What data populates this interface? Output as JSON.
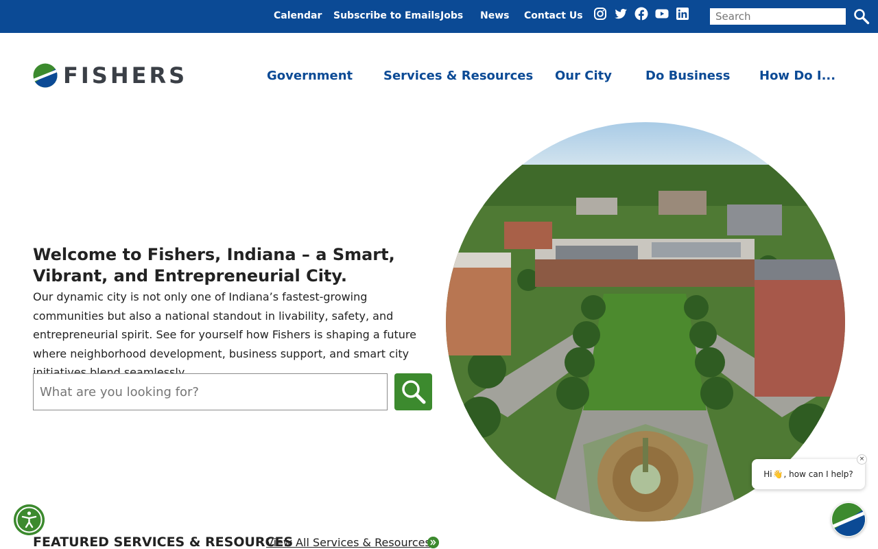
{
  "topbar": {
    "links": [
      "Calendar",
      "Subscribe to Emails",
      "Jobs",
      "News",
      "Contact Us"
    ],
    "social_icons": [
      "instagram-icon",
      "twitter-icon",
      "facebook-icon",
      "youtube-icon",
      "linkedin-icon"
    ],
    "search_placeholder": "Search",
    "color": "#0b4a95"
  },
  "header": {
    "logo_text": "FISHERS",
    "nav": [
      "Government",
      "Services & Resources",
      "Our City",
      "Do Business",
      "How Do I..."
    ]
  },
  "hero": {
    "title": "Welcome to Fishers, Indiana – a Smart, Vibrant, and Entrepreneurial City.",
    "body": "Our dynamic city is not only one of Indiana’s fastest-growing communities but also a national standout in livability, safety, and entrepreneurial spirit. See for yourself how Fishers is shaping a future where neighborhood development, business support, and smart city initiatives blend seamlessly.",
    "search_placeholder": "What are you looking for?",
    "search_icon": "search-icon"
  },
  "featured": {
    "title": "FEATURED SERVICES & RESOURCES",
    "link": "View All Services & Resources"
  },
  "chat": {
    "greeting_pre": "Hi",
    "greeting_post": ", how can I help?",
    "close": "×"
  },
  "colors": {
    "brand_blue": "#0b4a95",
    "brand_green": "#3c8a2e"
  }
}
